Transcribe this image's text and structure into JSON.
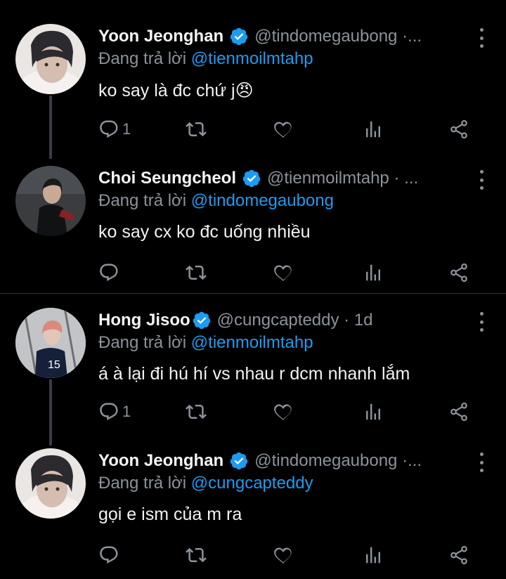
{
  "tweets": [
    {
      "name": "Yoon Jeonghan",
      "handle": "@tindomegaubong ·...",
      "reply_prefix": "Đang trả lời ",
      "reply_to": "@tienmoilmtahp",
      "text": "ko say là đc chứ j😠",
      "reply_count": "1",
      "avatar_icon": "avatar-photo"
    },
    {
      "name": "Choi Seungcheol",
      "handle": "@tienmoilmtahp · ...",
      "reply_prefix": "Đang trả lời ",
      "reply_to": "@tindomegaubong",
      "text": "ko say cx ko đc uống nhiều",
      "reply_count": "",
      "avatar_icon": "avatar-photo"
    },
    {
      "name": "Hong Jisoo",
      "handle": "@cungcapteddy · 1d",
      "reply_prefix": "Đang trả lời ",
      "reply_to": "@tienmoilmtahp",
      "text": "á à lại đi hú hí vs nhau r dcm nhanh lắm",
      "reply_count": "1",
      "avatar_icon": "avatar-photo"
    },
    {
      "name": "Yoon Jeonghan",
      "handle": "@tindomegaubong ·...",
      "reply_prefix": "Đang trả lời ",
      "reply_to": "@cungcapteddy",
      "text": "gọi e ism của m ra",
      "reply_count": "",
      "avatar_icon": "avatar-photo"
    }
  ],
  "colors": {
    "background": "#000000",
    "mention": "#1d9bf0",
    "muted": "#8b9299",
    "verified": "#1d9bf0"
  },
  "icons": [
    "reply-icon",
    "retweet-icon",
    "like-icon",
    "analytics-icon",
    "share-icon",
    "verified-icon",
    "more-icon"
  ]
}
